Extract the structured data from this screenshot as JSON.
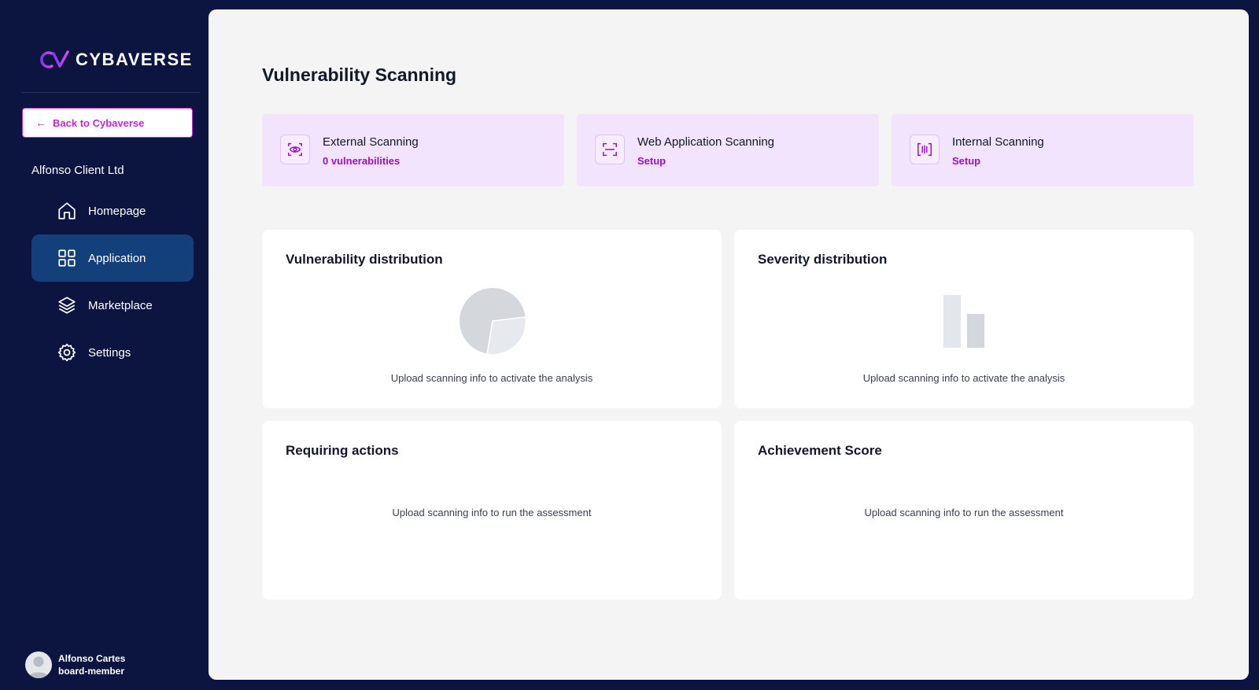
{
  "brand": {
    "name": "CYBAVERSE",
    "accent": "#c026d3"
  },
  "sidebar": {
    "back_label": "Back to Cybaverse",
    "client_name": "Alfonso Client Ltd",
    "items": [
      {
        "label": "Homepage",
        "icon": "home-icon"
      },
      {
        "label": "Application",
        "icon": "grid-icon",
        "active": true
      },
      {
        "label": "Marketplace",
        "icon": "layers-icon"
      },
      {
        "label": "Settings",
        "icon": "gear-icon"
      }
    ]
  },
  "user": {
    "name": "Alfonso Cartes",
    "role": "board-member"
  },
  "main": {
    "title": "Vulnerability Scanning",
    "scans": [
      {
        "title": "External Scanning",
        "sub": "0 vulnerabilities",
        "icon": "eye-scan-icon"
      },
      {
        "title": "Web Application Scanning",
        "sub": "Setup",
        "icon": "frame-scan-icon"
      },
      {
        "title": "Internal Scanning",
        "sub": "Setup",
        "icon": "barcode-scan-icon"
      }
    ],
    "panels": [
      {
        "title": "Vulnerability distribution",
        "message": "Upload scanning info to activate the analysis",
        "placeholder": "pie-placeholder"
      },
      {
        "title": "Severity distribution",
        "message": "Upload scanning info to activate the analysis",
        "placeholder": "bar-placeholder"
      },
      {
        "title": "Requiring actions",
        "message": "Upload scanning info to run the assessment"
      },
      {
        "title": "Achievement Score",
        "message": "Upload scanning info to run the assessment"
      }
    ]
  }
}
